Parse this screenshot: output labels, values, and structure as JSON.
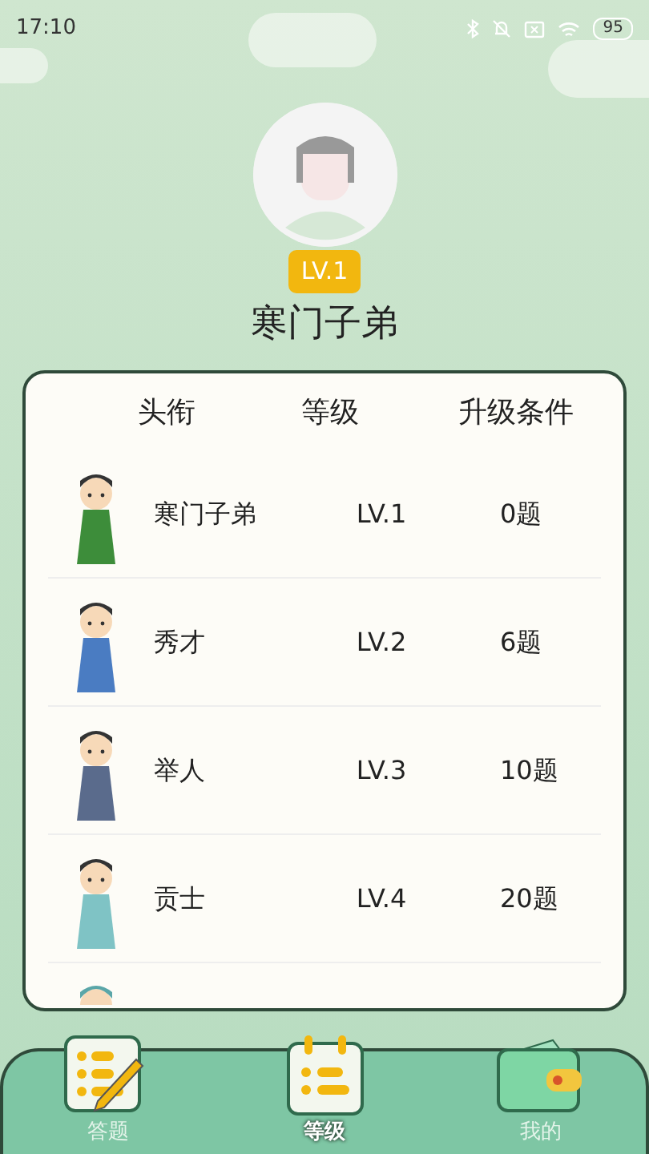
{
  "status_bar": {
    "time": "17:10",
    "battery": "95"
  },
  "profile": {
    "level_badge": "LV.1",
    "title": "寒门子弟"
  },
  "table": {
    "columns": [
      "头衔",
      "等级",
      "升级条件"
    ],
    "rows": [
      {
        "title": "寒门子弟",
        "level": "LV.1",
        "requirement": "0题"
      },
      {
        "title": "秀才",
        "level": "LV.2",
        "requirement": "6题"
      },
      {
        "title": "举人",
        "level": "LV.3",
        "requirement": "10题"
      },
      {
        "title": "贡士",
        "level": "LV.4",
        "requirement": "20题"
      }
    ]
  },
  "tabs": [
    {
      "label": "答题",
      "selected": false
    },
    {
      "label": "等级",
      "selected": true
    },
    {
      "label": "我的",
      "selected": false
    }
  ]
}
